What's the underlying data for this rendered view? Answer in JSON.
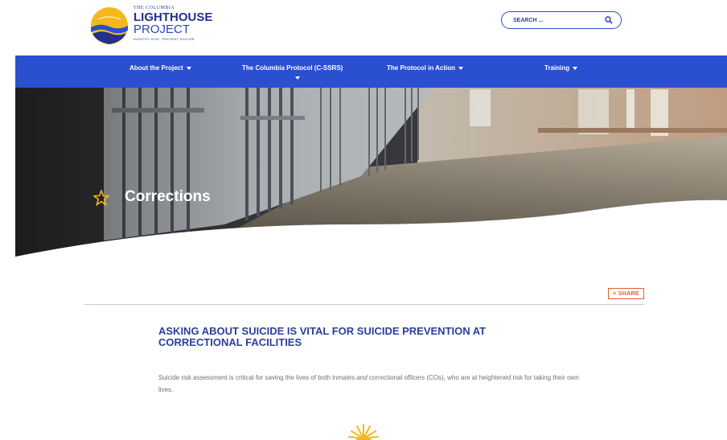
{
  "brand": {
    "pre_title": "THE COLUMBIA",
    "title": "LIGHTHOUSE",
    "subtitle": "PROJECT",
    "tagline": "IDENTIFY RISK. PREVENT SUICIDE."
  },
  "search": {
    "placeholder": "SEARCH ..."
  },
  "nav": {
    "items": [
      {
        "label": "About the Project"
      },
      {
        "label": "The Columbia Protocol (C-SSRS)"
      },
      {
        "label": "The Protocol in Action"
      },
      {
        "label": "Training"
      }
    ]
  },
  "hero": {
    "title": "Corrections"
  },
  "share": {
    "label": "+ SHARE"
  },
  "article": {
    "headline": "ASKING ABOUT SUICIDE IS VITAL FOR SUICIDE PREVENTION AT CORRECTIONAL FACILITIES",
    "body_before": "Suicide risk assessment is critical for saving the lives of both inmates ",
    "body_em": "and",
    "body_after": " correctional officers (COs), who are at heightened risk for taking their own lives."
  },
  "colors": {
    "brand_blue": "#2a4fd0",
    "navy": "#2a3f9a",
    "accent_orange": "#e0602c",
    "sun_yellow": "#f5b81c"
  },
  "icons": [
    "lighthouse-logo-icon",
    "search-icon",
    "chevron-down-icon",
    "star-icon",
    "sun-icon"
  ]
}
